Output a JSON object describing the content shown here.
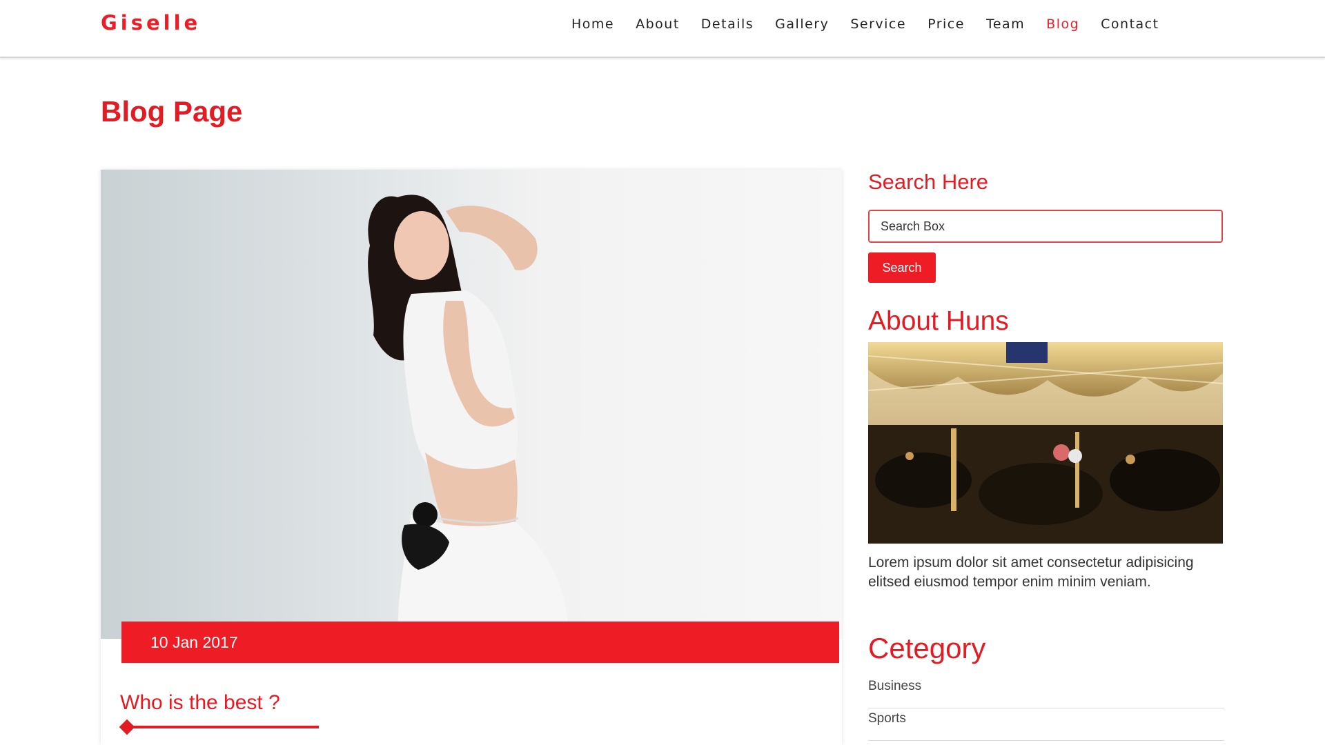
{
  "header": {
    "brand": "Giselle",
    "nav": [
      {
        "label": "Home",
        "active": false
      },
      {
        "label": "About",
        "active": false
      },
      {
        "label": "Details",
        "active": false
      },
      {
        "label": "Gallery",
        "active": false
      },
      {
        "label": "Service",
        "active": false
      },
      {
        "label": "Price",
        "active": false
      },
      {
        "label": "Team",
        "active": false
      },
      {
        "label": "Blog",
        "active": true
      },
      {
        "label": "Contact",
        "active": false
      }
    ]
  },
  "page": {
    "title": "Blog Page"
  },
  "post": {
    "date": "10 Jan 2017",
    "title": "Who is the best ?"
  },
  "sidebar": {
    "search": {
      "heading": "Search Here",
      "placeholder": "Search Box",
      "button_label": "Search"
    },
    "about": {
      "heading": "About Huns",
      "text": "Lorem ipsum dolor sit amet consectetur adipisicing elitsed eiusmod tempor enim minim veniam."
    },
    "category": {
      "heading": "Cetegory",
      "items": [
        "Business",
        "Sports"
      ]
    }
  },
  "colors": {
    "accent": "#ee1c25",
    "heading": "#e31b23",
    "text": "#333333"
  }
}
